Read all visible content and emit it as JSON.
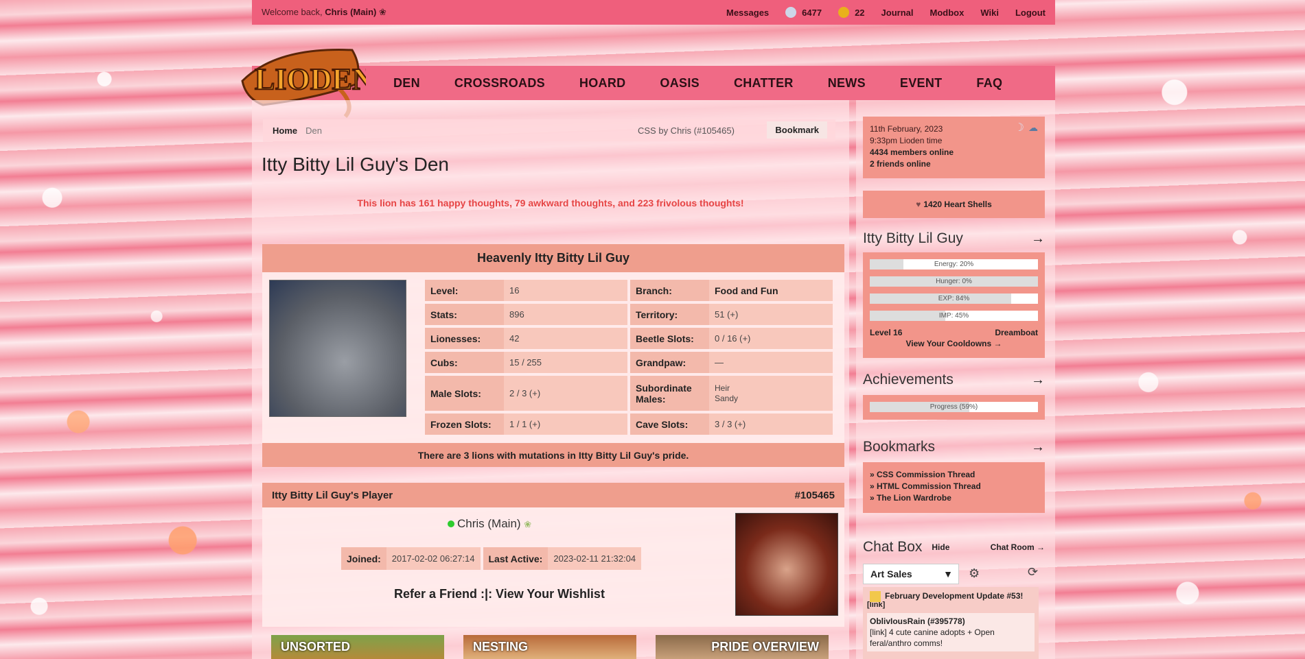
{
  "topbar": {
    "welcome_prefix": "Welcome back,",
    "user": "Chris (Main)",
    "links": [
      "Messages",
      "6477",
      "22",
      "Journal",
      "Modbox",
      "Wiki",
      "Logout"
    ]
  },
  "nav": [
    "DEN",
    "CROSSROADS",
    "HOARD",
    "OASIS",
    "CHATTER",
    "NEWS",
    "EVENT",
    "FAQ"
  ],
  "logo_text": "LIODEN",
  "breadcrumb": {
    "home": "Home",
    "current": "Den",
    "css_credit": "CSS by Chris (#105465)",
    "bookmark": "Bookmark"
  },
  "page_title": "Itty Bitty Lil Guy's Den",
  "thoughts": "This lion has 161 happy thoughts, 79 awkward thoughts, and 223 frivolous thoughts!",
  "lion": {
    "name": "Heavenly Itty Bitty Lil Guy",
    "stats_left": [
      {
        "k": "Level:",
        "v": "16"
      },
      {
        "k": "Stats:",
        "v": "896"
      },
      {
        "k": "Lionesses:",
        "v": "42"
      },
      {
        "k": "Cubs:",
        "v": "15 / 255"
      },
      {
        "k": "Male Slots:",
        "v": "2 / 3 (+)"
      },
      {
        "k": "Frozen Slots:",
        "v": "1 / 1 (+)"
      }
    ],
    "stats_right": [
      {
        "k": "Branch:",
        "v": "Food and Fun"
      },
      {
        "k": "Territory:",
        "v": "51 (+)"
      },
      {
        "k": "Beetle Slots:",
        "v": "0 / 16 (+)"
      },
      {
        "k": "Grandpaw:",
        "v": "—"
      },
      {
        "k": "Subordinate Males:",
        "v": "Heir",
        "v2": "Sandy"
      },
      {
        "k": "Cave Slots:",
        "v": "3 / 3 (+)"
      }
    ],
    "mutations": "There are 3 lions with mutations in Itty Bitty Lil Guy's pride."
  },
  "player": {
    "header": "Itty Bitty Lil Guy's Player",
    "id": "#105465",
    "name": "Chris (Main)",
    "joined_label": "Joined:",
    "joined": "2017-02-02 06:27:14",
    "active_label": "Last Active:",
    "active": "2023-02-11 21:32:04",
    "refer": "Refer a Friend :|: View Your Wishlist"
  },
  "tabs": [
    "UNSORTED",
    "NESTING",
    "PRIDE OVERVIEW"
  ],
  "sidebar": {
    "date": "11th February, 2023",
    "time": "9:33pm Lioden time",
    "members": "4434 members online",
    "friends": "2 friends online",
    "shells": "1420 Heart Shells",
    "lion_title": "Itty Bitty Lil Guy",
    "bars": [
      {
        "label": "Energy: 20%",
        "pct": 20
      },
      {
        "label": "Hunger: 0%",
        "pct": 0
      },
      {
        "label": "EXP: 84%",
        "pct": 84
      },
      {
        "label": "IMP: 45%",
        "pct": 45
      }
    ],
    "level": "Level 16",
    "rank": "Dreamboat",
    "cooldowns": "View Your Cooldowns →",
    "achievements_title": "Achievements",
    "achievements_bar": {
      "label": "Progress (59%)",
      "pct": 59
    },
    "bookmarks_title": "Bookmarks",
    "bookmarks": [
      "» CSS Commission Thread",
      "» HTML Commission Thread",
      "» The Lion Wardrobe"
    ],
    "chat_title": "Chat Box",
    "chat_hide": "Hide",
    "chat_room": "Chat Room →",
    "chat_select": "Art Sales",
    "msg1": "February Development Update #53!",
    "msg1_link": "[link]",
    "msg2_user": "OblivIousRain (#395778)",
    "msg2_text": "[link] 4 cute canine adopts + Open feral/anthro comms!"
  }
}
